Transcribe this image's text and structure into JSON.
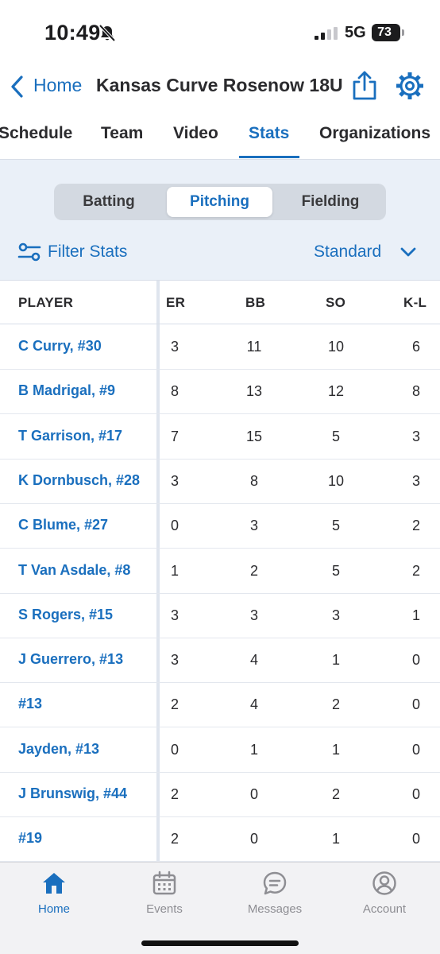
{
  "status_bar": {
    "time": "10:49",
    "network": "5G",
    "battery": "73"
  },
  "nav": {
    "back_label": "Home",
    "title": "Kansas Curve Rosenow 18U"
  },
  "tabs": [
    {
      "label": "Schedule"
    },
    {
      "label": "Team"
    },
    {
      "label": "Video"
    },
    {
      "label": "Stats",
      "active": true
    },
    {
      "label": "Organizations"
    }
  ],
  "segments": [
    {
      "label": "Batting"
    },
    {
      "label": "Pitching",
      "active": true
    },
    {
      "label": "Fielding"
    }
  ],
  "filter": {
    "label": "Filter Stats",
    "view": "Standard"
  },
  "table": {
    "headers": {
      "player": "PLAYER",
      "er": "ER",
      "bb": "BB",
      "so": "SO",
      "kl": "K-L"
    },
    "rows": [
      {
        "player": "C Curry, #30",
        "er": "3",
        "bb": "11",
        "so": "10",
        "kl": "6"
      },
      {
        "player": "B Madrigal, #9",
        "er": "8",
        "bb": "13",
        "so": "12",
        "kl": "8"
      },
      {
        "player": "T Garrison, #17",
        "er": "7",
        "bb": "15",
        "so": "5",
        "kl": "3"
      },
      {
        "player": "K Dornbusch, #28",
        "er": "3",
        "bb": "8",
        "so": "10",
        "kl": "3"
      },
      {
        "player": "C Blume, #27",
        "er": "0",
        "bb": "3",
        "so": "5",
        "kl": "2"
      },
      {
        "player": "T Van Asdale, #8",
        "er": "1",
        "bb": "2",
        "so": "5",
        "kl": "2"
      },
      {
        "player": "S Rogers, #15",
        "er": "3",
        "bb": "3",
        "so": "3",
        "kl": "1"
      },
      {
        "player": "J Guerrero, #13",
        "er": "3",
        "bb": "4",
        "so": "1",
        "kl": "0"
      },
      {
        "player": "#13",
        "er": "2",
        "bb": "4",
        "so": "2",
        "kl": "0"
      },
      {
        "player": "Jayden, #13",
        "er": "0",
        "bb": "1",
        "so": "1",
        "kl": "0"
      },
      {
        "player": "J Brunswig, #44",
        "er": "2",
        "bb": "0",
        "so": "2",
        "kl": "0"
      },
      {
        "player": "#19",
        "er": "2",
        "bb": "0",
        "so": "1",
        "kl": "0"
      }
    ]
  },
  "bottom_nav": [
    {
      "label": "Home",
      "icon": "home-icon",
      "active": true
    },
    {
      "label": "Events",
      "icon": "calendar-icon"
    },
    {
      "label": "Messages",
      "icon": "messages-icon"
    },
    {
      "label": "Account",
      "icon": "account-icon"
    }
  ],
  "colors": {
    "accent": "#1a6fbe",
    "filter_background": "#eaf0f8",
    "inactive": "#8e8e93"
  }
}
